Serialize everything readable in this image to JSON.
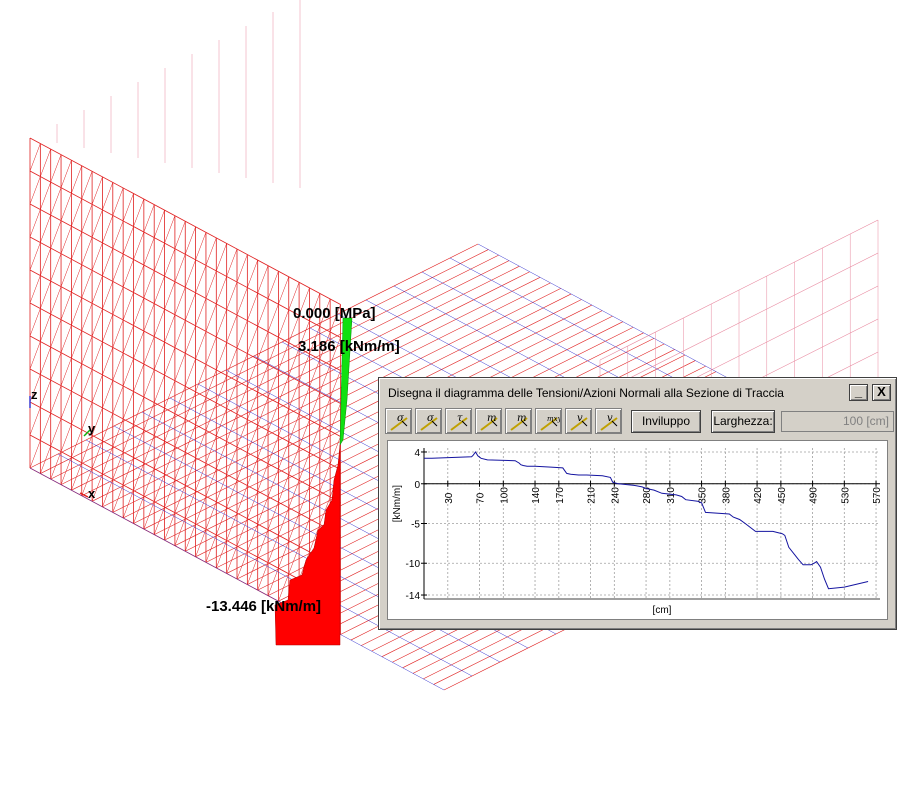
{
  "scene": {
    "labels": {
      "top_stress": "0.000 [MPa]",
      "top_moment": "3.186 [kNm/m]",
      "bottom_moment": "-13.446 [kNm/m]"
    },
    "axes": {
      "z": "z",
      "y": "y",
      "x": "x"
    },
    "colors": {
      "mesh_red": "#e02020",
      "mesh_blue": "#3a3ad0",
      "mesh_pink": "#e88aa0",
      "positive_fill": "#10e010",
      "negative_fill": "#ff0000"
    }
  },
  "dialog": {
    "title": "Disegna il diagramma delle Tensioni/Azioni Normali alla Sezione di Traccia",
    "minimize_label": "_",
    "close_label": "X",
    "tools": [
      {
        "name": "sigma-tool",
        "glyph": "σ"
      },
      {
        "name": "sigma-c-tool",
        "glyph": "σ"
      },
      {
        "name": "tau-tool",
        "glyph": "τ"
      },
      {
        "name": "m-tool",
        "glyph": "m"
      },
      {
        "name": "m2-tool",
        "glyph": "m"
      },
      {
        "name": "mxy-tool",
        "glyph": "mxy"
      },
      {
        "name": "v-tool",
        "glyph": "v"
      },
      {
        "name": "v2-tool",
        "glyph": "v"
      }
    ],
    "envelope_label": "Inviluppo",
    "width_label": "Larghezza:",
    "width_value": "100 [cm]"
  },
  "chart_data": {
    "type": "line",
    "xlabel": "[cm]",
    "ylabel": "[kNm/m]",
    "x_ticks": [
      30,
      70,
      100,
      140,
      170,
      210,
      240,
      280,
      310,
      350,
      380,
      420,
      450,
      490,
      530,
      570
    ],
    "y_ticks": [
      4,
      0,
      -5,
      -10,
      -14
    ],
    "xlim": [
      0,
      575
    ],
    "ylim": [
      -14.5,
      4.5
    ],
    "grid": true,
    "series_color": "#1414a0",
    "x": [
      0,
      10,
      60,
      62,
      65,
      68,
      72,
      80,
      115,
      120,
      122,
      125,
      130,
      140,
      160,
      175,
      180,
      185,
      195,
      205,
      225,
      235,
      238,
      245,
      265,
      275,
      280,
      290,
      300,
      318,
      325,
      330,
      345,
      350,
      355,
      385,
      390,
      398,
      405,
      418,
      440,
      448,
      452,
      455,
      460,
      472,
      478,
      488,
      492,
      495,
      500,
      505,
      510,
      530,
      560
    ],
    "y": [
      3.2,
      3.2,
      3.4,
      3.6,
      4.0,
      3.5,
      3.2,
      3.0,
      2.9,
      2.6,
      2.4,
      2.3,
      2.2,
      2.2,
      2.1,
      2.0,
      1.3,
      1.2,
      1.1,
      1.1,
      1.0,
      0.8,
      0.2,
      0.0,
      -0.2,
      -0.4,
      -0.6,
      -0.8,
      -1.2,
      -1.4,
      -1.6,
      -2.0,
      -2.2,
      -2.4,
      -3.6,
      -3.8,
      -4.2,
      -4.5,
      -5.0,
      -6.0,
      -6.0,
      -6.2,
      -6.3,
      -6.5,
      -8.0,
      -9.5,
      -10.2,
      -10.2,
      -10.0,
      -9.8,
      -10.5,
      -12.0,
      -13.2,
      -13.0,
      -12.3
    ]
  }
}
